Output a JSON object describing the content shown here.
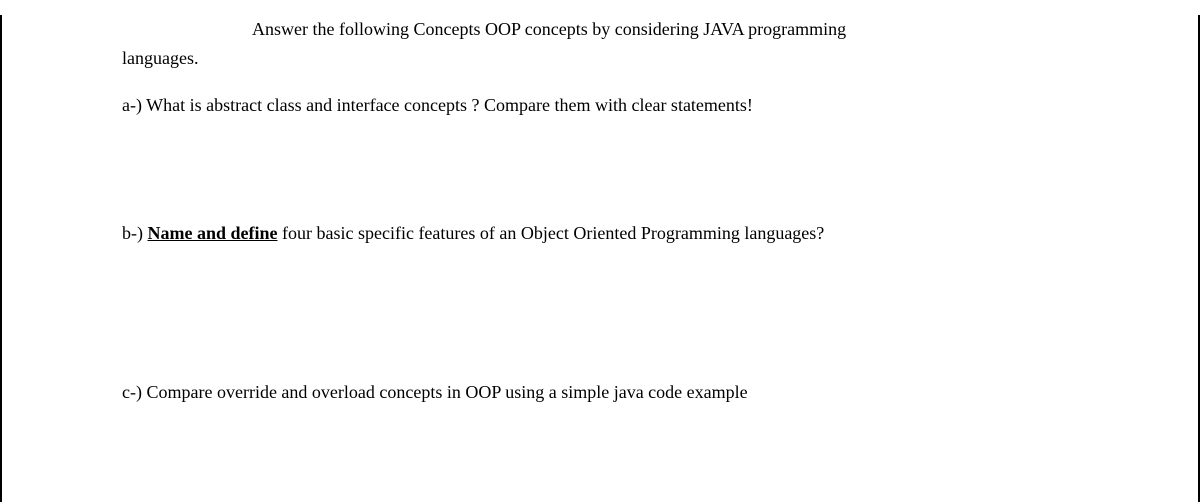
{
  "document": {
    "intro": {
      "line1": "Answer the following Concepts OOP concepts by considering JAVA programming",
      "line2": "languages."
    },
    "questions": {
      "a": {
        "prefix": "a-) ",
        "text": "What is abstract class and interface concepts ? Compare them with clear statements!"
      },
      "b": {
        "prefix": "b-) ",
        "underlined": "Name and define",
        "rest": " four basic specific features of an Object Oriented Programming languages?"
      },
      "c": {
        "prefix": "c-) ",
        "text": "Compare override and overload concepts in OOP using a simple java code example"
      }
    }
  }
}
